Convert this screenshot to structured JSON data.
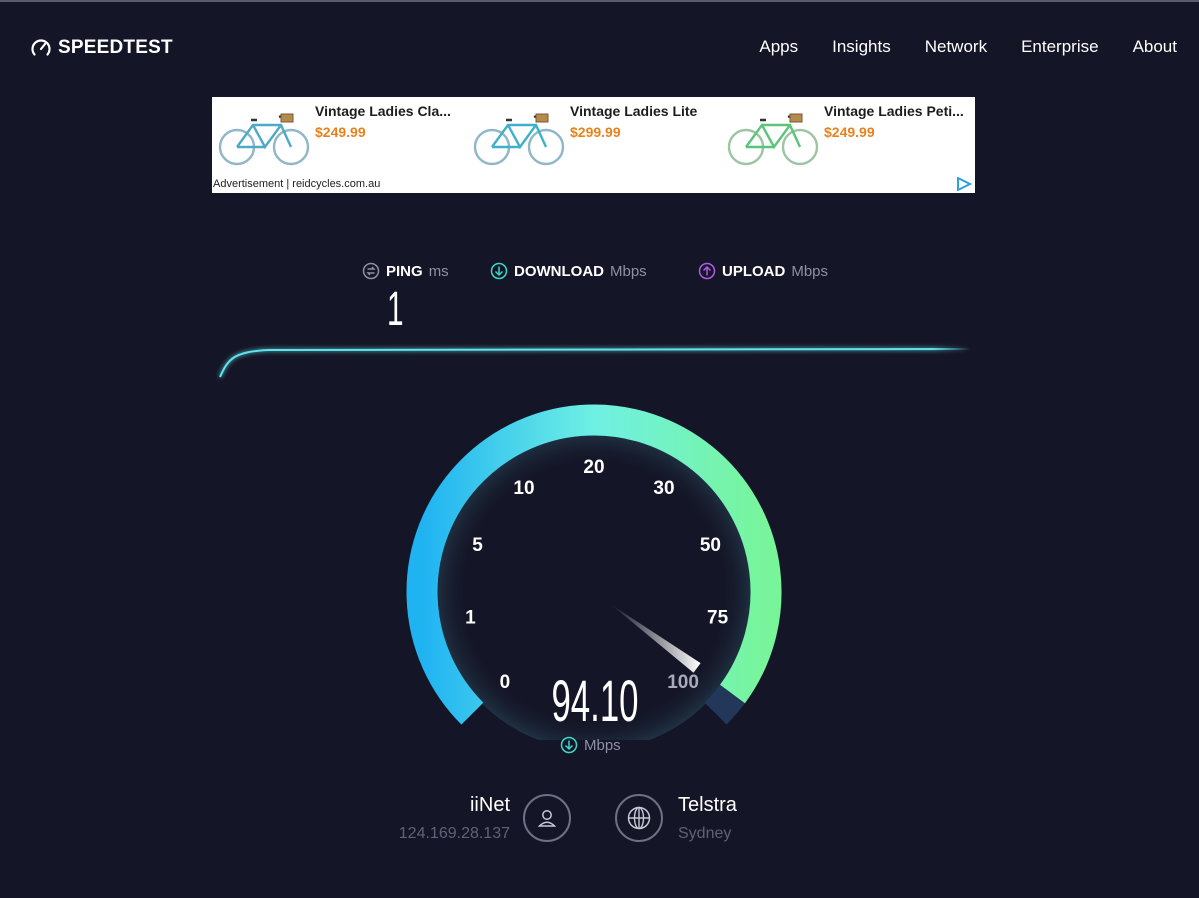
{
  "header": {
    "logo_text": "SPEEDTEST",
    "nav": [
      "Apps",
      "Insights",
      "Network",
      "Enterprise",
      "About"
    ]
  },
  "ad": {
    "items": [
      {
        "title": "Vintage Ladies Cla...",
        "price": "$249.99",
        "bike_color": "#4fa9c6"
      },
      {
        "title": "Vintage Ladies Lite",
        "price": "$299.99",
        "bike_color": "#3fb0c9"
      },
      {
        "title": "Vintage Ladies Peti...",
        "price": "$249.99",
        "bike_color": "#5cc37a"
      }
    ],
    "footer": "Advertisement | reidcycles.com.au"
  },
  "metrics": {
    "ping": {
      "label": "PING",
      "unit": "ms",
      "value": "1",
      "color": "#8e90a6"
    },
    "download": {
      "label": "DOWNLOAD",
      "unit": "Mbps",
      "color": "#3bd9c8"
    },
    "upload": {
      "label": "UPLOAD",
      "unit": "Mbps",
      "color": "#b45ae6"
    }
  },
  "gauge": {
    "ticks": [
      "0",
      "1",
      "5",
      "10",
      "20",
      "30",
      "50",
      "75",
      "100"
    ],
    "value": "94.10",
    "value_fraction": 0.968,
    "unit": "Mbps",
    "colors": {
      "start": "#1fb3f2",
      "top": "#6ff0e4",
      "end": "#78f59a"
    }
  },
  "isp": {
    "name": "iiNet",
    "ip": "124.169.28.137"
  },
  "server": {
    "name": "Telstra",
    "location": "Sydney"
  }
}
